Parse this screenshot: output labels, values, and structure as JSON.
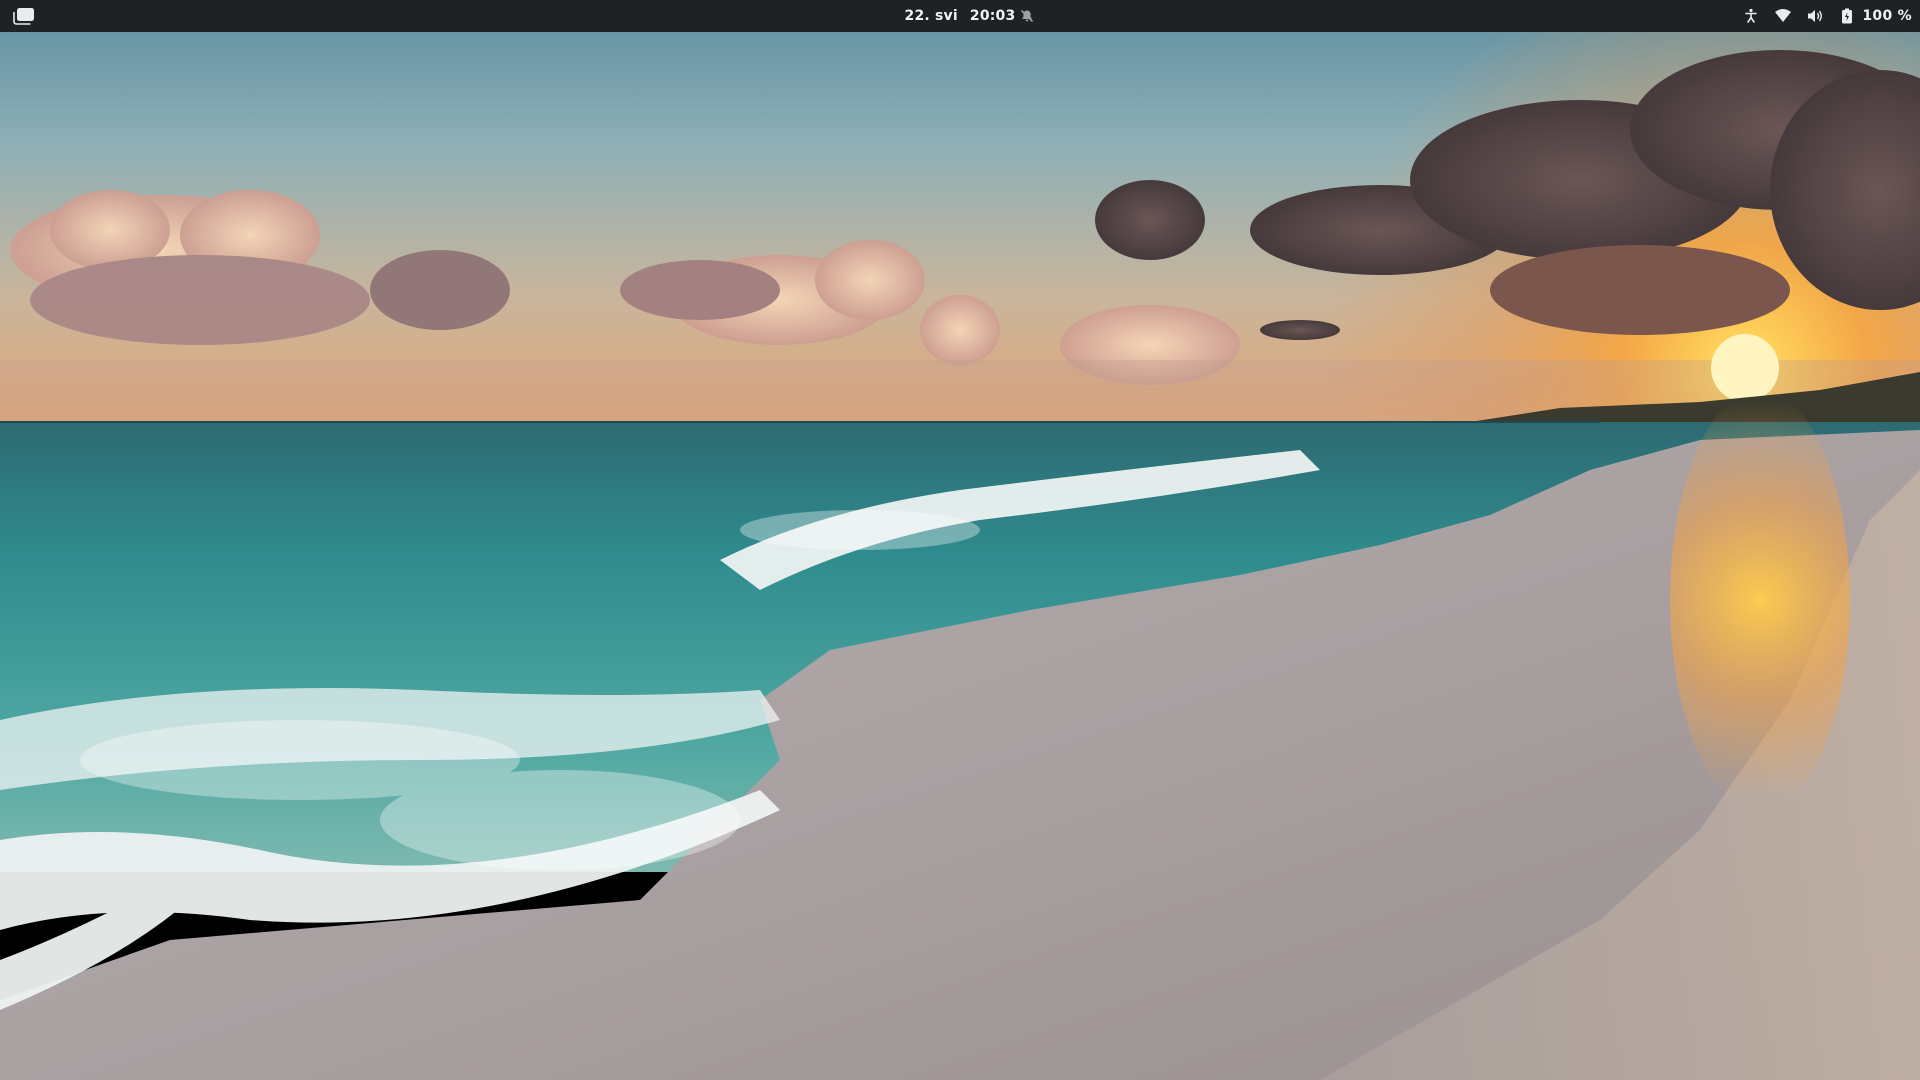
{
  "top_bar": {
    "activities": {
      "icon": "overview-icon"
    },
    "clock": {
      "date": "22. svi",
      "time": "20:03"
    },
    "notification_icon": "bell-muted-icon",
    "tray": {
      "accessibility_icon": "accessibility-icon",
      "network_icon": "wifi-icon",
      "volume_icon": "volume-icon",
      "battery_icon": "battery-icon",
      "battery_percent": "100 %"
    }
  },
  "wallpaper": {
    "description_icon": "beach-sunset-wallpaper"
  },
  "colors": {
    "panel_bg": "#1e2225",
    "panel_text": "#f2f2f2"
  }
}
